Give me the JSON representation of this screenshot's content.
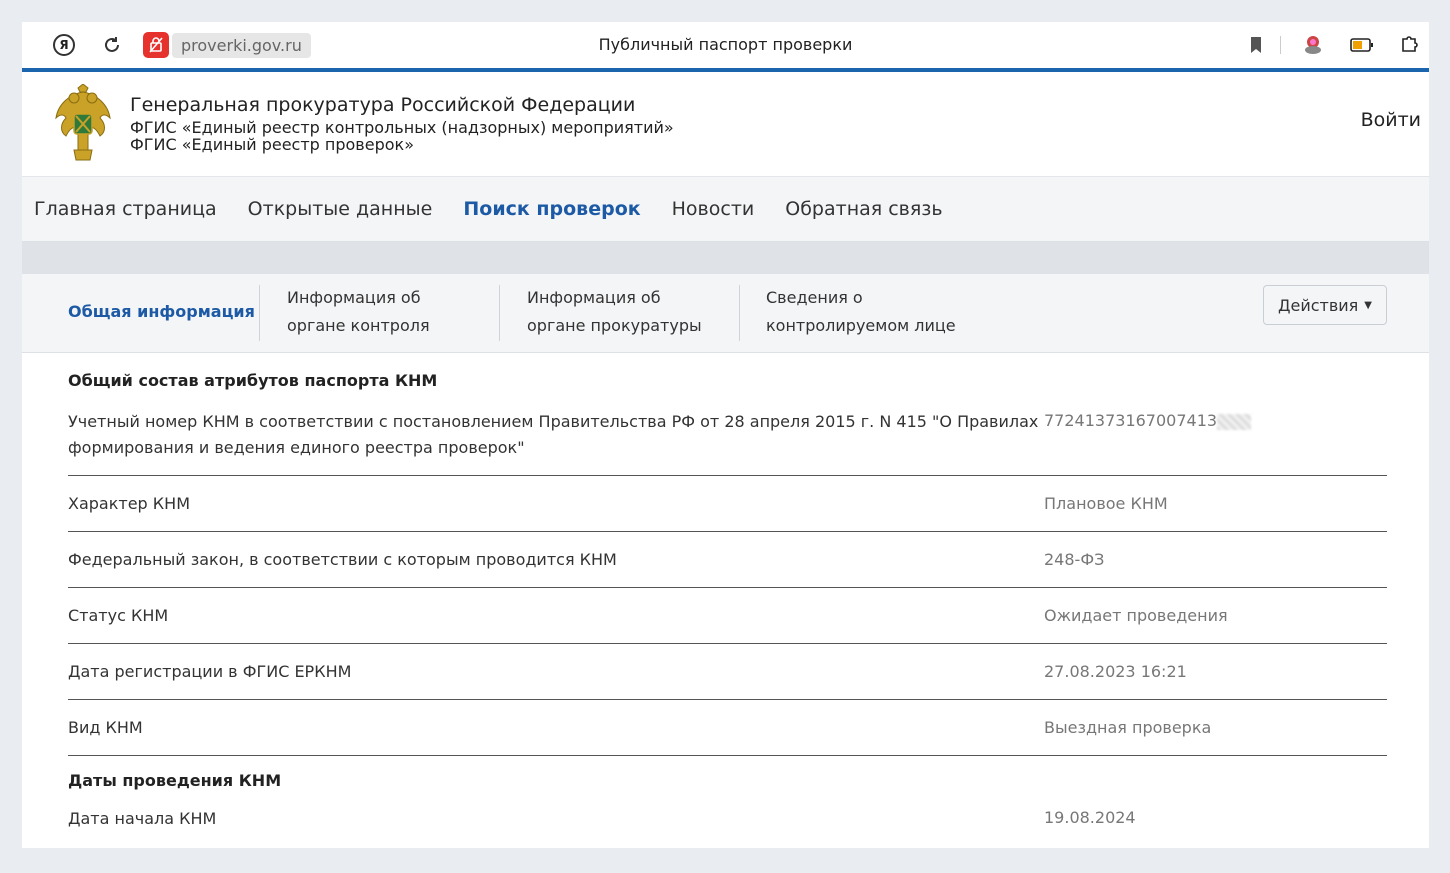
{
  "browser": {
    "url": "proverki.gov.ru",
    "tab_title": "Публичный паспорт проверки"
  },
  "header": {
    "org_title": "Генеральная прокуратура Российской Федерации",
    "org_subtitle_1": "ФГИС «Единый реестр контрольных (надзорных) мероприятий»",
    "org_subtitle_2": "ФГИС «Единый реестр проверок»",
    "login": "Войти"
  },
  "nav": {
    "items": [
      {
        "label": "Главная страница"
      },
      {
        "label": "Открытые данные"
      },
      {
        "label": "Поиск проверок"
      },
      {
        "label": "Новости"
      },
      {
        "label": "Обратная связь"
      }
    ],
    "active_index": 2
  },
  "subtabs": {
    "items": [
      {
        "line1": "Общая информация",
        "line2": ""
      },
      {
        "line1": "Информация об",
        "line2": "органе контроля"
      },
      {
        "line1": "Информация об",
        "line2": "органе прокуратуры"
      },
      {
        "line1": "Сведения о",
        "line2": "контролируемом лице"
      }
    ],
    "actions_label": "Действия"
  },
  "content": {
    "section1_title": "Общий состав атрибутов паспорта КНМ",
    "section2_title": "Даты проведения КНМ",
    "rows": [
      {
        "label": "Учетный номер КНМ в соответствии с постановлением Правительства РФ от 28 апреля 2015 г. N 415 \"О Правилах формирования и ведения единого реестра проверок\"",
        "value": "77241373167007413"
      },
      {
        "label": "Характер КНМ",
        "value": "Плановое КНМ"
      },
      {
        "label": "Федеральный закон, в соответствии с которым проводится КНМ",
        "value": "248-ФЗ"
      },
      {
        "label": "Статус КНМ",
        "value": "Ожидает проведения"
      },
      {
        "label": "Дата регистрации в ФГИС ЕРКНМ",
        "value": "27.08.2023 16:21"
      },
      {
        "label": "Вид КНМ",
        "value": "Выездная проверка"
      },
      {
        "label": "Дата начала КНМ",
        "value": "19.08.2024"
      }
    ]
  },
  "colors": {
    "accent": "#1d5aa5",
    "browser_stripe": "#1b64ae",
    "badge_red": "#e5322d"
  }
}
